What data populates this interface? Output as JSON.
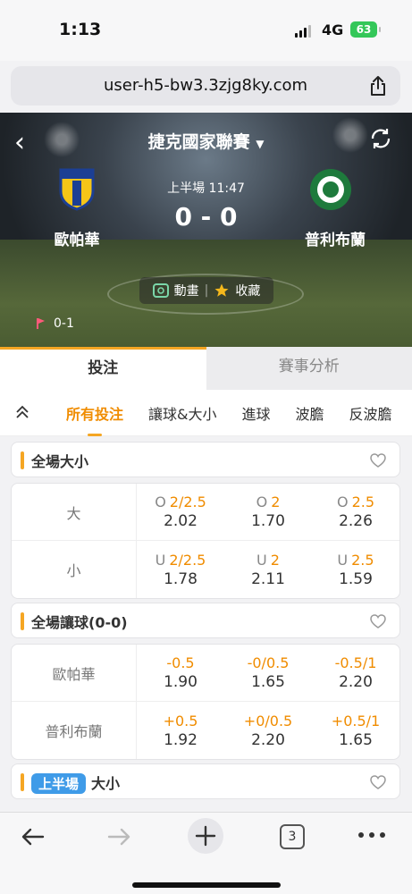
{
  "status_bar": {
    "time": "1:13",
    "network": "4G",
    "battery": "63"
  },
  "browser": {
    "url": "user-h5-bw3.3zjg8ky.com"
  },
  "match": {
    "league": "捷克國家聯賽",
    "period": "上半場",
    "clock": "11:47",
    "score": "0 - 0",
    "home_team": "歐帕華",
    "away_team": "普利布蘭",
    "animation_label": "動畫",
    "favorite_label": "收藏",
    "corner_score": "0-1"
  },
  "main_tabs": [
    {
      "label": "投注",
      "active": true
    },
    {
      "label": "賽事分析",
      "active": false
    }
  ],
  "sub_tabs": [
    {
      "label": "所有投注",
      "active": true
    },
    {
      "label": "讓球&大小",
      "active": false
    },
    {
      "label": "進球",
      "active": false
    },
    {
      "label": "波膽",
      "active": false
    },
    {
      "label": "反波膽",
      "active": false
    }
  ],
  "sections": {
    "full_over_under": {
      "title": "全場大小",
      "rows": [
        {
          "label": "大",
          "cells": [
            {
              "prefix": "O",
              "line": "2/2.5",
              "price": "2.02"
            },
            {
              "prefix": "O",
              "line": "2",
              "price": "1.70"
            },
            {
              "prefix": "O",
              "line": "2.5",
              "price": "2.26"
            }
          ]
        },
        {
          "label": "小",
          "cells": [
            {
              "prefix": "U",
              "line": "2/2.5",
              "price": "1.78"
            },
            {
              "prefix": "U",
              "line": "2",
              "price": "2.11"
            },
            {
              "prefix": "U",
              "line": "2.5",
              "price": "1.59"
            }
          ]
        }
      ]
    },
    "full_handicap": {
      "title": "全場讓球(0-0)",
      "rows": [
        {
          "label": "歐帕華",
          "cells": [
            {
              "line": "-0.5",
              "price": "1.90"
            },
            {
              "line": "-0/0.5",
              "price": "1.65"
            },
            {
              "line": "-0.5/1",
              "price": "2.20"
            }
          ]
        },
        {
          "label": "普利布蘭",
          "cells": [
            {
              "line": "+0.5",
              "price": "1.92"
            },
            {
              "line": "+0/0.5",
              "price": "2.20"
            },
            {
              "line": "+0.5/1",
              "price": "1.65"
            }
          ]
        }
      ]
    },
    "half_over_under": {
      "badge": "上半場",
      "title": "大小"
    }
  },
  "bottom_nav": {
    "tab_count": "3"
  },
  "colors": {
    "accent": "#f5a623",
    "odds_line": "#f08c00",
    "half_badge": "#3f9be8",
    "battery": "#34c759"
  }
}
